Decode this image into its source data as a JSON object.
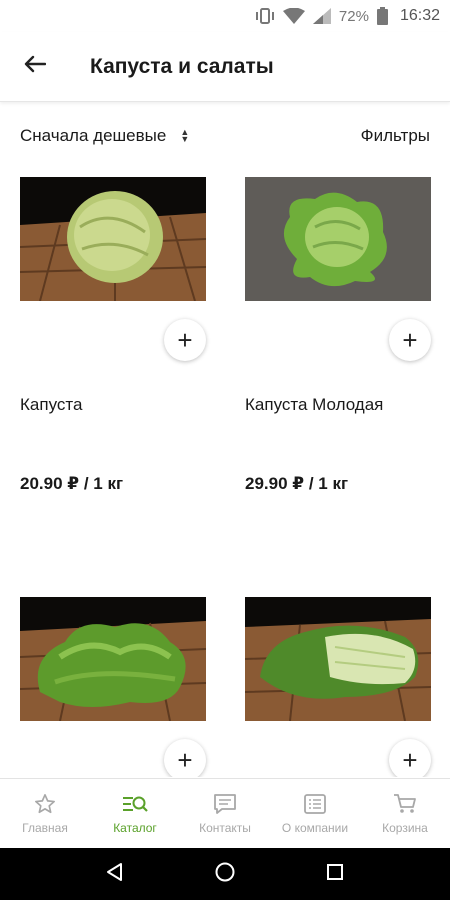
{
  "status_bar": {
    "battery": "72%",
    "time": "16:32"
  },
  "header": {
    "title": "Капуста и салаты"
  },
  "toolbar": {
    "sort_label": "Сначала дешевые",
    "filters_label": "Фильтры"
  },
  "products": [
    {
      "name": "Капуста",
      "price": "20.90 ₽ / 1 кг"
    },
    {
      "name": "Капуста Молодая",
      "price": "29.90 ₽ / 1 кг"
    },
    {
      "name": "",
      "price": ""
    },
    {
      "name": "",
      "price": ""
    }
  ],
  "add_symbol": "+",
  "bottom_nav": [
    {
      "label": "Главная",
      "icon": "star-icon"
    },
    {
      "label": "Каталог",
      "icon": "catalog-search-icon",
      "active": true
    },
    {
      "label": "Контакты",
      "icon": "chat-icon"
    },
    {
      "label": "О компании",
      "icon": "info-card-icon"
    },
    {
      "label": "Корзина",
      "icon": "cart-icon"
    }
  ],
  "colors": {
    "accent": "#5aa12a",
    "nav_inactive": "#a8a8a8",
    "system_bar": "#000000"
  }
}
